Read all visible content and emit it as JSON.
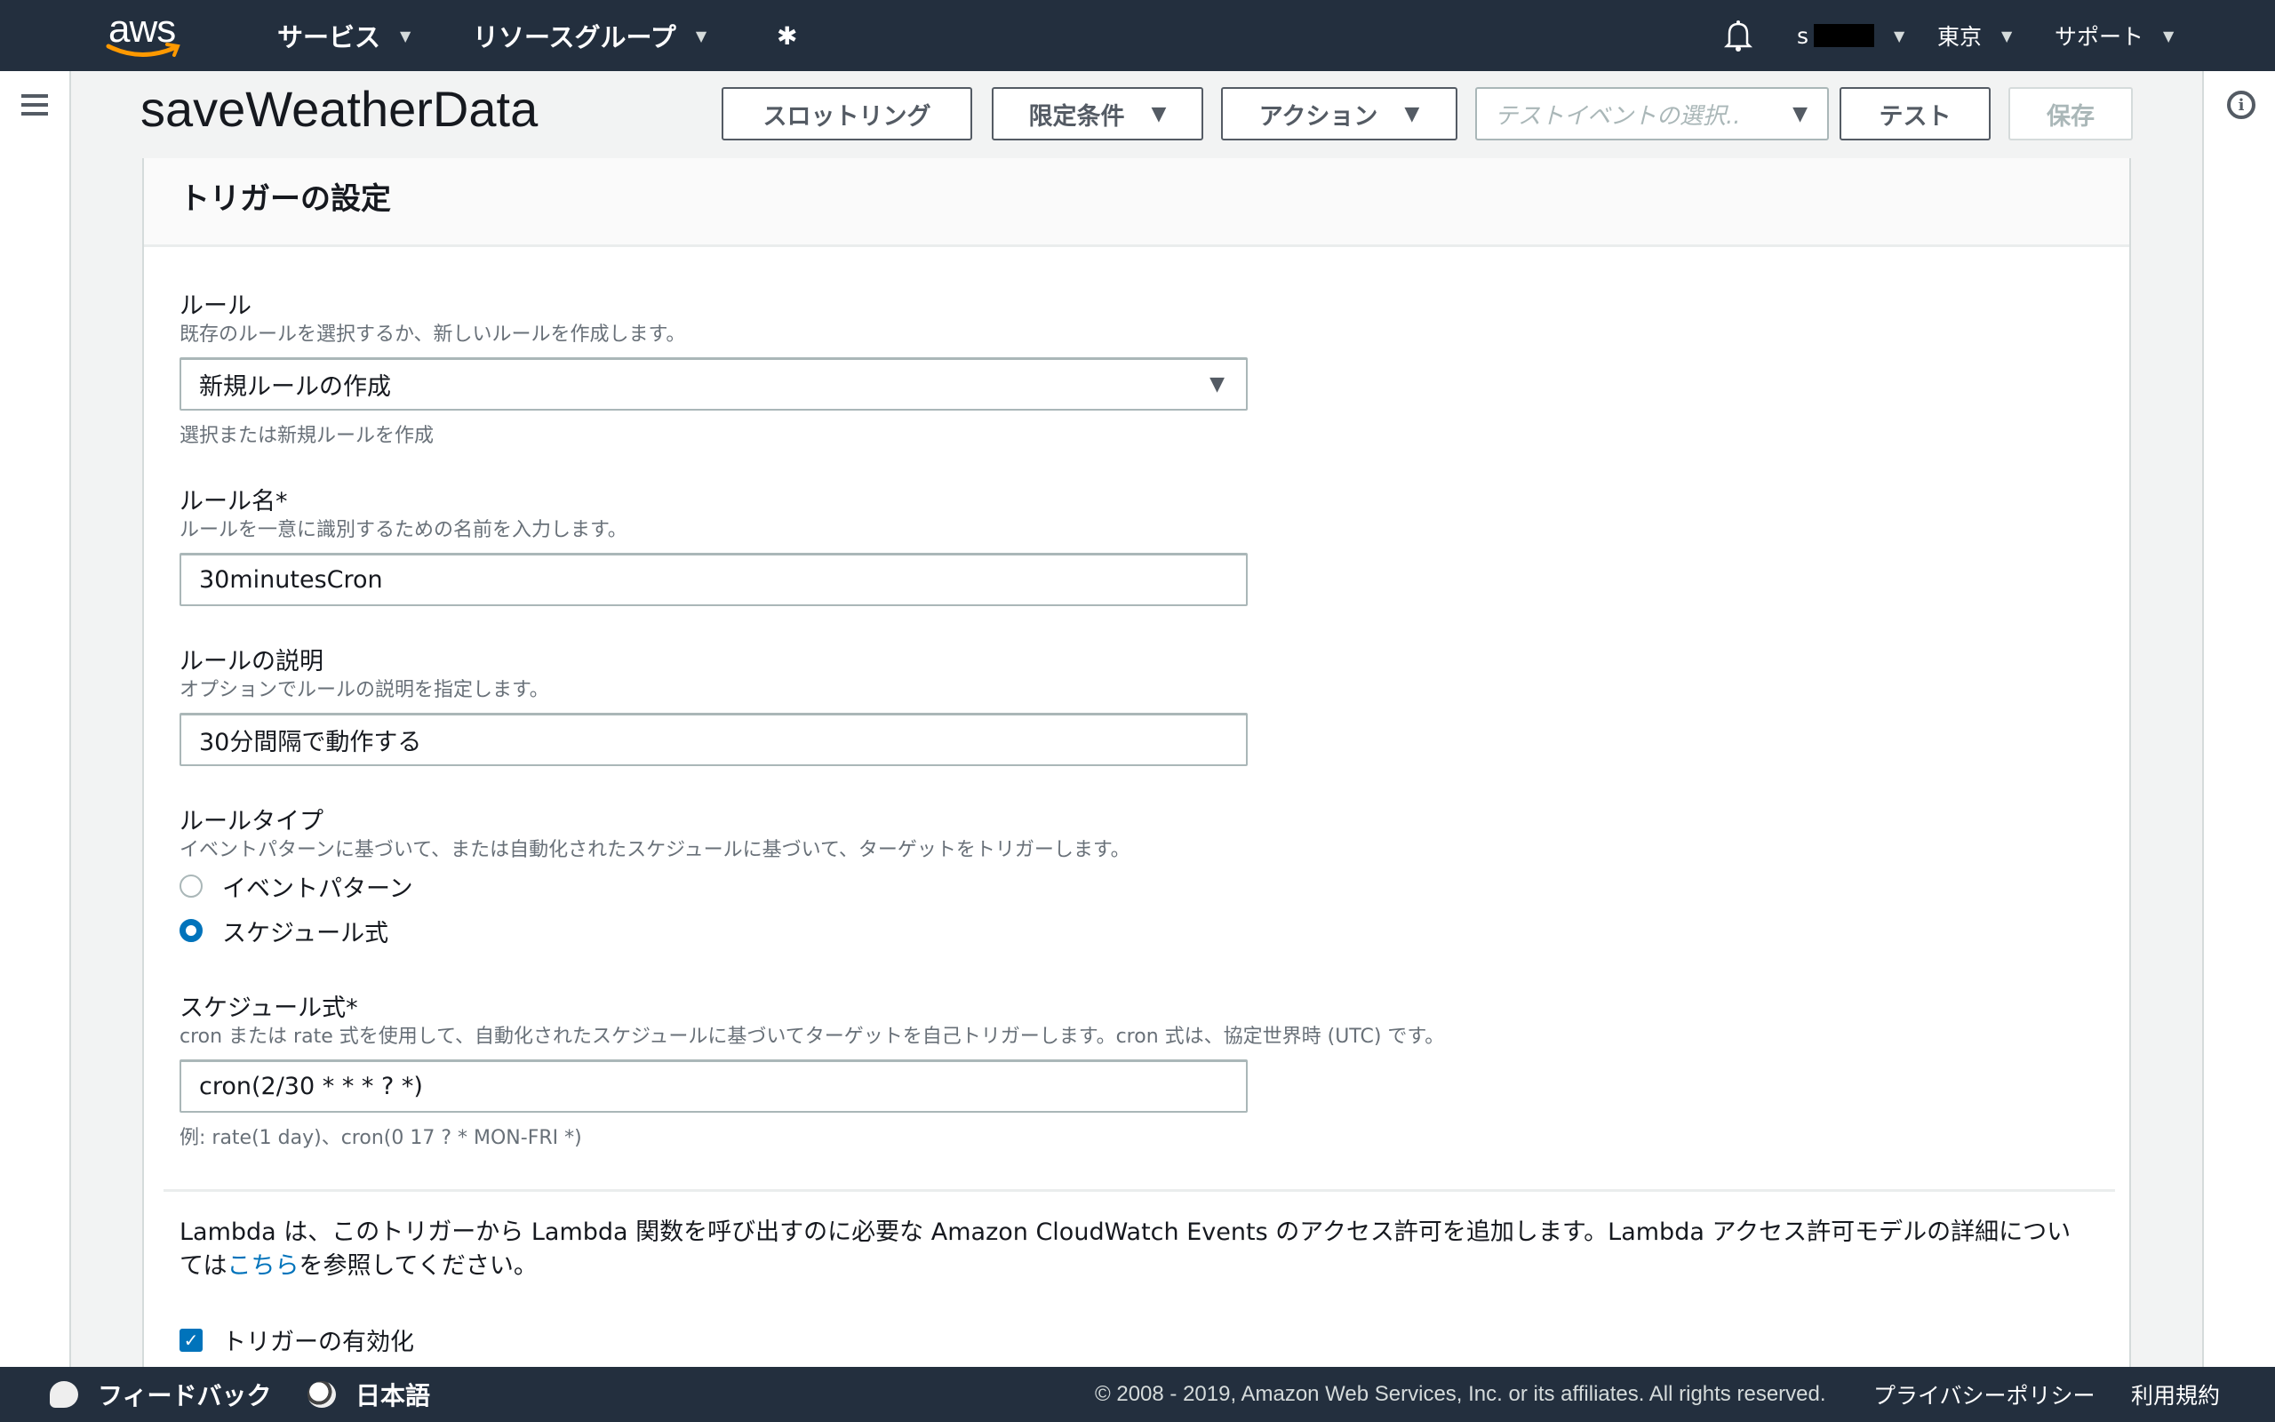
{
  "topnav": {
    "logo_text": "aws",
    "services": "サービス",
    "resource_groups": "リソースグループ",
    "account_prefix": "s",
    "region": "東京",
    "support": "サポート"
  },
  "header": {
    "title": "saveWeatherData",
    "throttling": "スロットリング",
    "qualifiers": "限定条件",
    "actions": "アクション",
    "test_event_placeholder": "テストイベントの選択..",
    "test": "テスト",
    "save": "保存"
  },
  "panel": {
    "title": "トリガーの設定",
    "rule": {
      "label": "ルール",
      "description": "既存のルールを選択するか、新しいルールを作成します。",
      "selected": "新規ルールの作成",
      "hint": "選択または新規ルールを作成"
    },
    "rule_name": {
      "label": "ルール名*",
      "description": "ルールを一意に識別するための名前を入力します。",
      "value": "30minutesCron"
    },
    "rule_description": {
      "label": "ルールの説明",
      "description": "オプションでルールの説明を指定します。",
      "value": "30分間隔で動作する"
    },
    "rule_type": {
      "label": "ルールタイプ",
      "description": "イベントパターンに基づいて、または自動化されたスケジュールに基づいて、ターゲットをトリガーします。",
      "options": [
        {
          "label": "イベントパターン",
          "checked": false
        },
        {
          "label": "スケジュール式",
          "checked": true
        }
      ]
    },
    "schedule": {
      "label": "スケジュール式*",
      "description": "cron または rate 式を使用して、自動化されたスケジュールに基づいてターゲットを自己トリガーします。cron 式は、協定世界時 (UTC) です。",
      "value": "cron(2/30 * * * ? *)",
      "example": "例: rate(1 day)、cron(0 17 ? * MON-FRI *)"
    },
    "note": {
      "text_before": "Lambda は、このトリガーから Lambda 関数を呼び出すのに必要な Amazon CloudWatch Events のアクセス許可を追加します。Lambda アクセス許可モデルの詳細については",
      "link": "こちら",
      "text_after": "を参照してください。"
    },
    "enable_trigger": {
      "label": "トリガーの有効化",
      "checked": true
    }
  },
  "footer": {
    "feedback": "フィードバック",
    "language": "日本語",
    "copyright": "© 2008 - 2019, Amazon Web Services, Inc. or its affiliates. All rights reserved.",
    "privacy": "プライバシーポリシー",
    "terms": "利用規約"
  },
  "colors": {
    "nav_bg": "#232f3e",
    "accent": "#0073bb",
    "aws_orange": "#ff9900"
  }
}
